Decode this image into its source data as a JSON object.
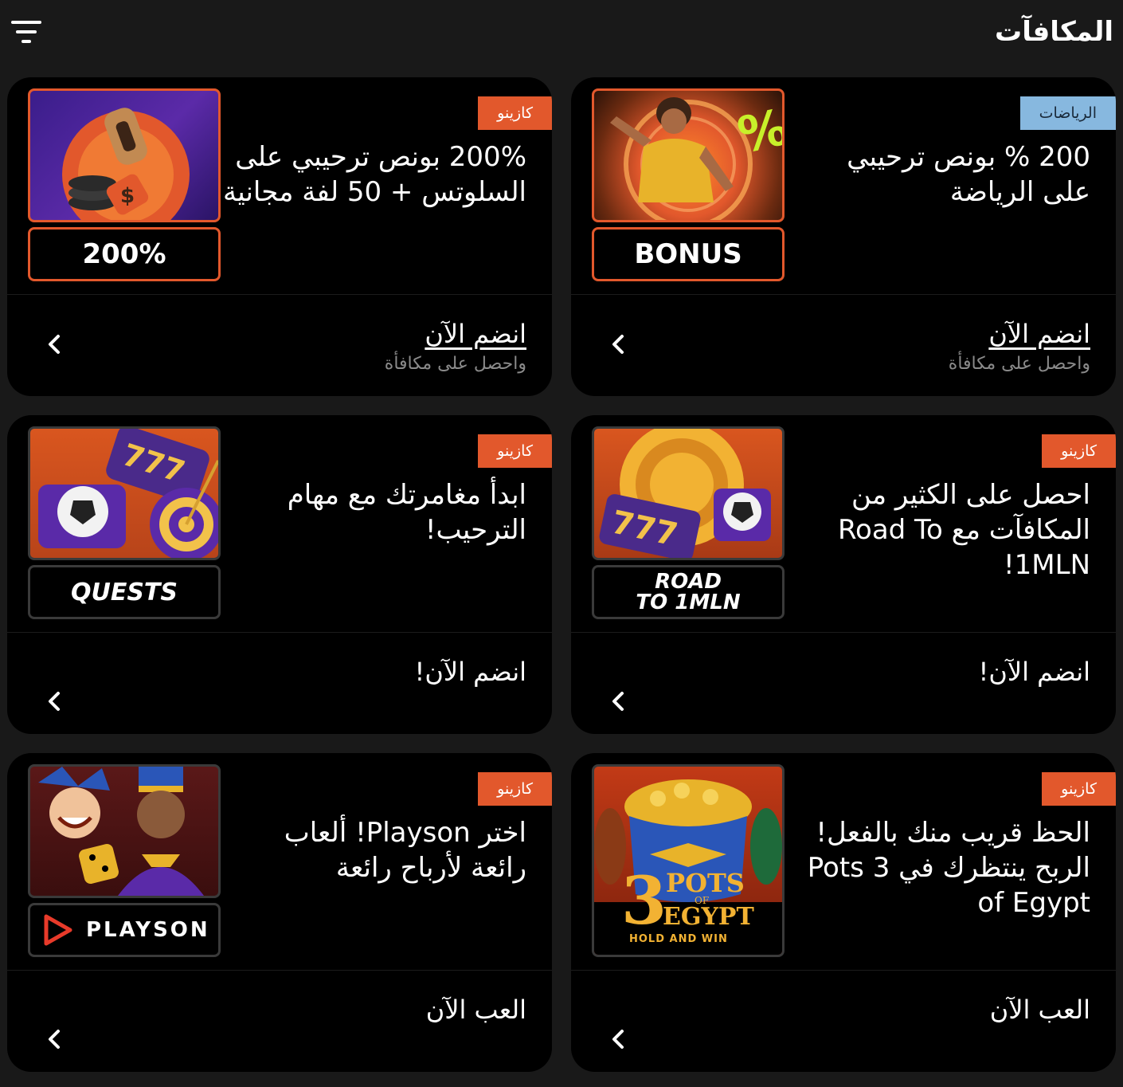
{
  "header": {
    "title": "المكافآت",
    "filter_icon": "filter-icon"
  },
  "cards": [
    {
      "badge": "الرياضات",
      "title": "200 % بونص ترحيبي على الرياضة",
      "plate": "BONUS",
      "cta": "انضم الآن",
      "cta_sub": "واحصل على مكافأة"
    },
    {
      "badge": "كازينو",
      "title": "200% بونص ترحيبي على السلوتس + 50 لفة مجانية",
      "plate": "200%",
      "cta": "انضم الآن",
      "cta_sub": "واحصل على مكافأة"
    },
    {
      "badge": "كازينو",
      "title": "احصل على الكثير من المكافآت مع Road To 1MLN!",
      "plate_line1": "ROAD",
      "plate_line2": "TO 1MLN",
      "cta": "انضم الآن!"
    },
    {
      "badge": "كازينو",
      "title": "ابدأ مغامرتك مع مهام الترحيب!",
      "plate": "QUESTS",
      "cta": "انضم الآن!"
    },
    {
      "badge": "كازينو",
      "title": "الحظ قريب منك بالفعل! الربح ينتظرك في 3 Pots of Egypt",
      "art_big": "3",
      "art_l1": "POTS",
      "art_l2": "OF",
      "art_l3": "EGYPT",
      "art_l4": "HOLD AND WIN",
      "cta": "العب الآن"
    },
    {
      "badge": "كازينو",
      "title": "اختر Playson! ألعاب رائعة لأرباح رائعة",
      "plate": "PLAYSON",
      "cta": "العب الآن"
    }
  ]
}
